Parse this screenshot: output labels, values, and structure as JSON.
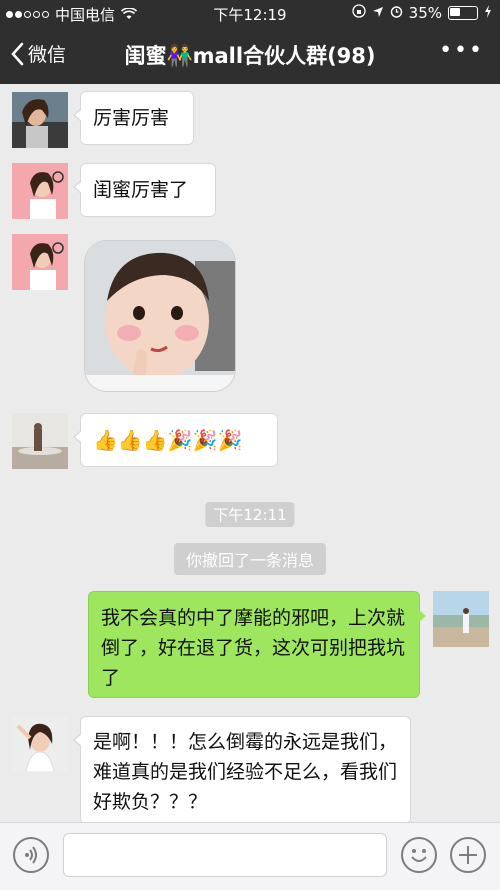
{
  "status_bar": {
    "carrier": "中国电信",
    "time": "下午12:19",
    "battery": "35%"
  },
  "nav": {
    "back_label": "微信",
    "title": "闺蜜👫mall合伙人群(98)",
    "more": "•••"
  },
  "messages": [
    {
      "side": "left",
      "text": "厉害厉害"
    },
    {
      "side": "left",
      "text": "闺蜜厉害了"
    },
    {
      "side": "left",
      "type": "image",
      "text": ""
    },
    {
      "side": "left",
      "text": "👍👍👍🎉🎉🎉"
    },
    {
      "side": "right",
      "text": "我不会真的中了摩能的邪吧，上次就倒了，好在退了货，这次可别把我坑了"
    },
    {
      "side": "left",
      "text": "是啊！！！怎么倒霉的永远是我们，难道真的是我们经验不足么，看我们好欺负？？？"
    }
  ],
  "timestamp": "下午12:11",
  "recall_notice": "你撤回了一条消息",
  "input": {
    "placeholder": ""
  },
  "colors": {
    "bar": "#2f2f2f",
    "bg": "#ebebeb",
    "self_bubble": "#9fe65f"
  }
}
